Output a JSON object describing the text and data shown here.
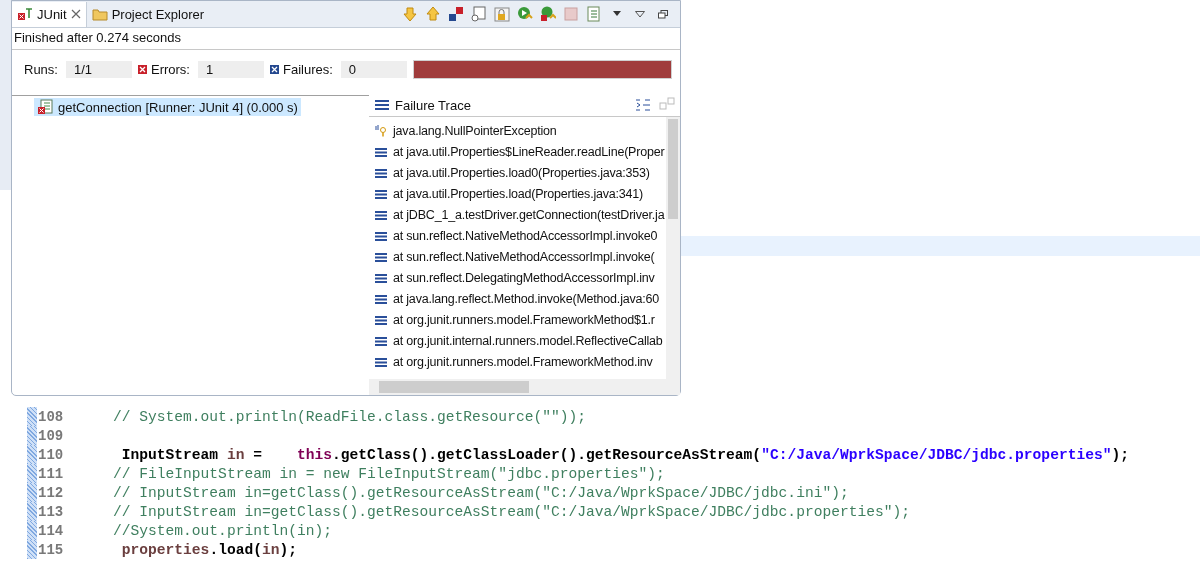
{
  "panel": {
    "tabs": [
      {
        "label": "JUnit",
        "selected": true,
        "closable": true
      },
      {
        "label": "Project Explorer",
        "selected": false,
        "closable": false
      }
    ],
    "status": "Finished after 0.274 seconds",
    "counters": [
      {
        "kind": "runs",
        "label": "Runs:",
        "value": "1/1"
      },
      {
        "kind": "errors",
        "label": "Errors:",
        "value": "1"
      },
      {
        "kind": "failures",
        "label": "Failures:",
        "value": "0"
      }
    ],
    "progress": {
      "level": 1
    },
    "tests": [
      {
        "label": "getConnection [Runner: JUnit 4] (0.000 s)",
        "selected": true
      }
    ],
    "trace": {
      "title": "Failure Trace",
      "lines": [
        {
          "kind": "exception",
          "text": "java.lang.NullPointerException"
        },
        {
          "kind": "frame",
          "text": "at java.util.Properties$LineReader.readLine(Proper"
        },
        {
          "kind": "frame",
          "text": "at java.util.Properties.load0(Properties.java:353)"
        },
        {
          "kind": "frame",
          "text": "at java.util.Properties.load(Properties.java:341)"
        },
        {
          "kind": "frame",
          "text": "at jDBC_1_a.testDriver.getConnection(testDriver.ja"
        },
        {
          "kind": "frame",
          "text": "at sun.reflect.NativeMethodAccessorImpl.invoke0"
        },
        {
          "kind": "frame",
          "text": "at sun.reflect.NativeMethodAccessorImpl.invoke("
        },
        {
          "kind": "frame",
          "text": "at sun.reflect.DelegatingMethodAccessorImpl.inv"
        },
        {
          "kind": "frame",
          "text": "at java.lang.reflect.Method.invoke(Method.java:60"
        },
        {
          "kind": "frame",
          "text": "at org.junit.runners.model.FrameworkMethod$1.r"
        },
        {
          "kind": "frame",
          "text": "at org.junit.internal.runners.model.ReflectiveCallab"
        },
        {
          "kind": "frame",
          "text": "at org.junit.runners.model.FrameworkMethod.inv"
        }
      ]
    }
  },
  "editor": {
    "lines": [
      {
        "number": "108",
        "tokens": [
          {
            "kind": "comment",
            "text": "    // System.out.println(ReadFile.class.getResource(\"\"));"
          }
        ]
      },
      {
        "number": "109"
      },
      {
        "number": "110",
        "tokens": [
          {
            "kind": "plain",
            "text": "     InputStream "
          },
          {
            "kind": "variable",
            "text": "in"
          },
          {
            "kind": "plain",
            "text": " =    "
          },
          {
            "kind": "keyword",
            "text": "this"
          },
          {
            "kind": "plain",
            "text": ".getClass().getClassLoader().getResourceAsStream("
          },
          {
            "kind": "string",
            "text": "\"C:/Java/WprkSpace/JDBC/jdbc.properties\""
          },
          {
            "kind": "plain",
            "text": ");"
          }
        ]
      },
      {
        "number": "111",
        "tokens": [
          {
            "kind": "comment",
            "text": "    // FileInputStream in = new FileInputStream(\"jdbc.properties\");"
          }
        ]
      },
      {
        "number": "112",
        "tokens": [
          {
            "kind": "comment",
            "text": "    // InputStream in=getClass().getResourceAsStream(\"C:/Java/WprkSpace/JDBC/jdbc.ini\");"
          }
        ]
      },
      {
        "number": "113",
        "tokens": [
          {
            "kind": "comment",
            "text": "    // InputStream in=getClass().getResourceAsStream(\"C:/Java/WprkSpace/JDBC/jdbc.properties\");"
          }
        ]
      },
      {
        "number": "114",
        "tokens": [
          {
            "kind": "comment",
            "text": "    //System.out.println(in);"
          }
        ]
      },
      {
        "number": "115",
        "tokens": [
          {
            "kind": "variable",
            "text": "     properties"
          },
          {
            "kind": "plain",
            "text": ".load("
          },
          {
            "kind": "variable",
            "text": "in"
          },
          {
            "kind": "plain",
            "text": ");"
          }
        ]
      }
    ]
  }
}
